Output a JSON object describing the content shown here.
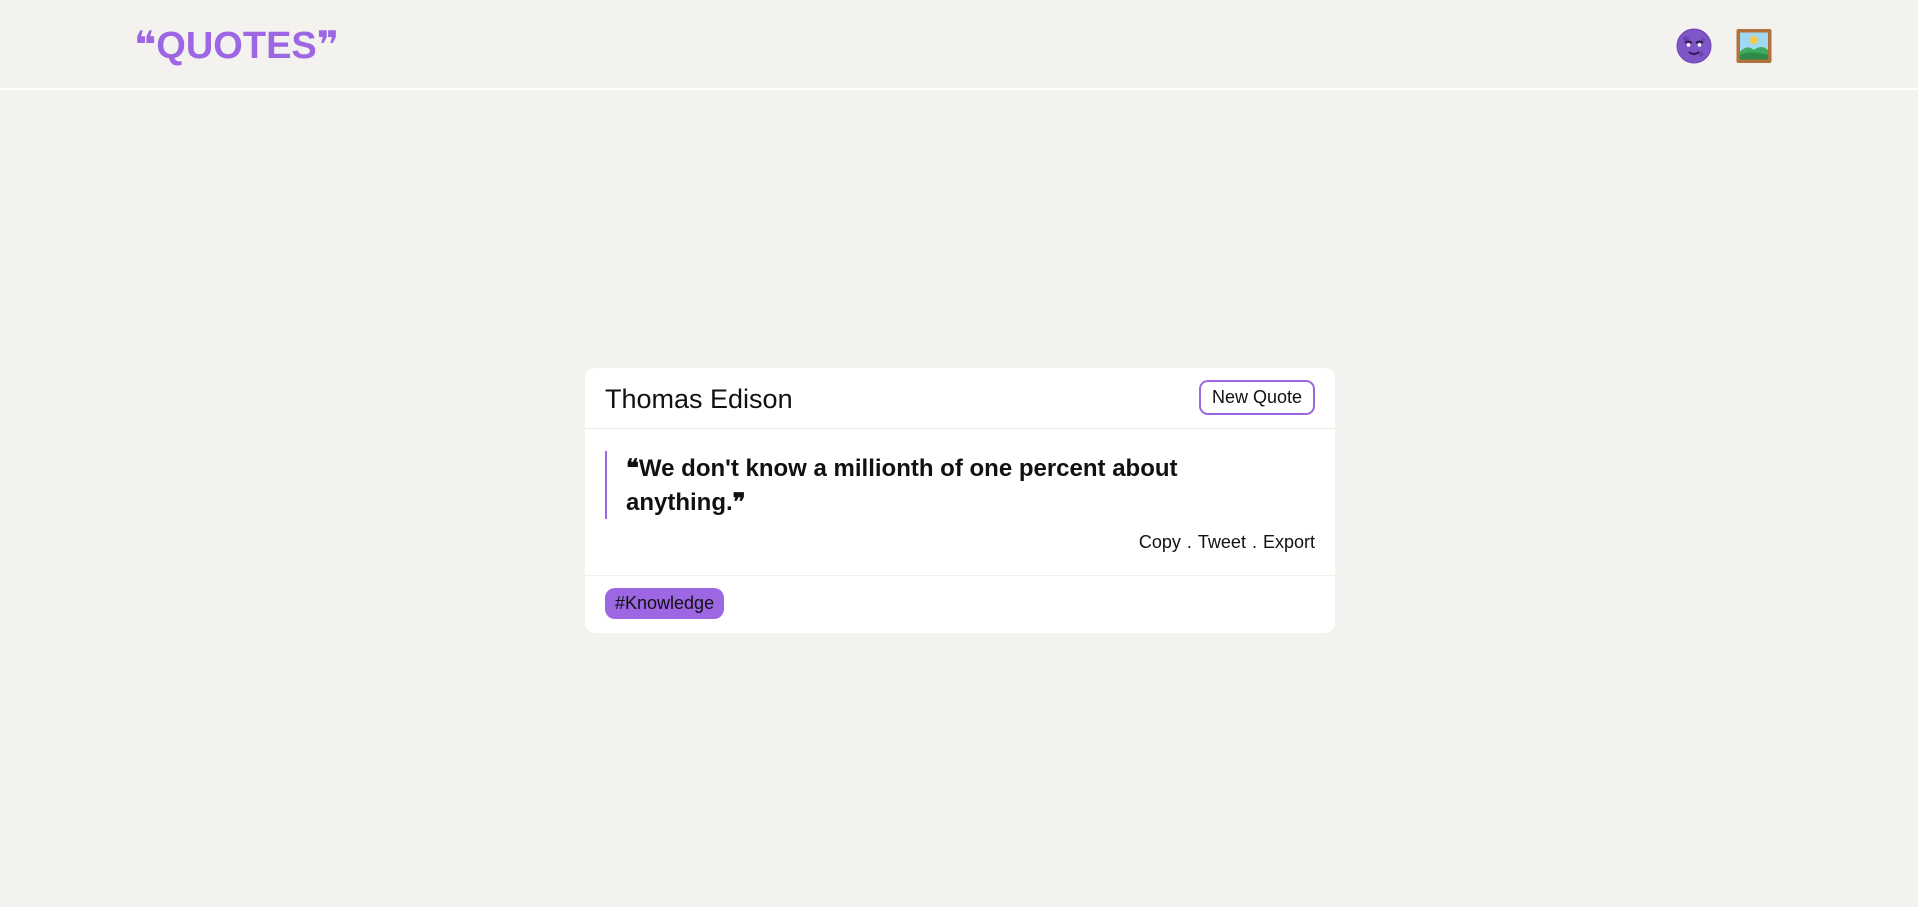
{
  "header": {
    "brand": "❝QUOTES❞",
    "icons": [
      "dark-mode-moon-icon",
      "image-export-picture-icon"
    ]
  },
  "quote_card": {
    "author": "Thomas Edison",
    "new_quote_label": "New Quote",
    "open_mark": "❝",
    "text": "We don't know a millionth of one percent about anything.",
    "close_mark": "❞",
    "actions": {
      "copy": "Copy",
      "tweet": "Tweet",
      "export": "Export",
      "separator": "."
    },
    "tag": "#Knowledge"
  },
  "colors": {
    "accent": "#9d66e2",
    "background": "#f3f2ef",
    "card": "#ffffff",
    "text": "#111111"
  }
}
